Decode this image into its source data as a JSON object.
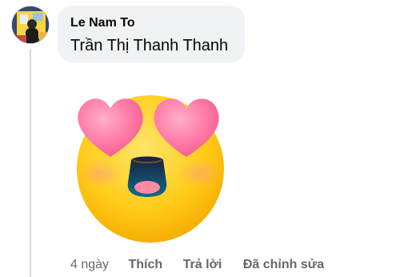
{
  "comment": {
    "author": "Le Nam To",
    "text": "Trần Thị Thanh Thanh",
    "sticker": "heart-eyes-emoji",
    "actions": {
      "timestamp": "4 ngày",
      "like_label": "Thích",
      "reply_label": "Trả lời",
      "edited_label": "Đã chỉnh sửa"
    }
  },
  "colors": {
    "bubble_bg": "#f0f2f5",
    "text_primary": "#050505",
    "text_secondary": "#65676b",
    "emoji_face": "#ffc800",
    "emoji_hearts": "#ff6fa0"
  }
}
